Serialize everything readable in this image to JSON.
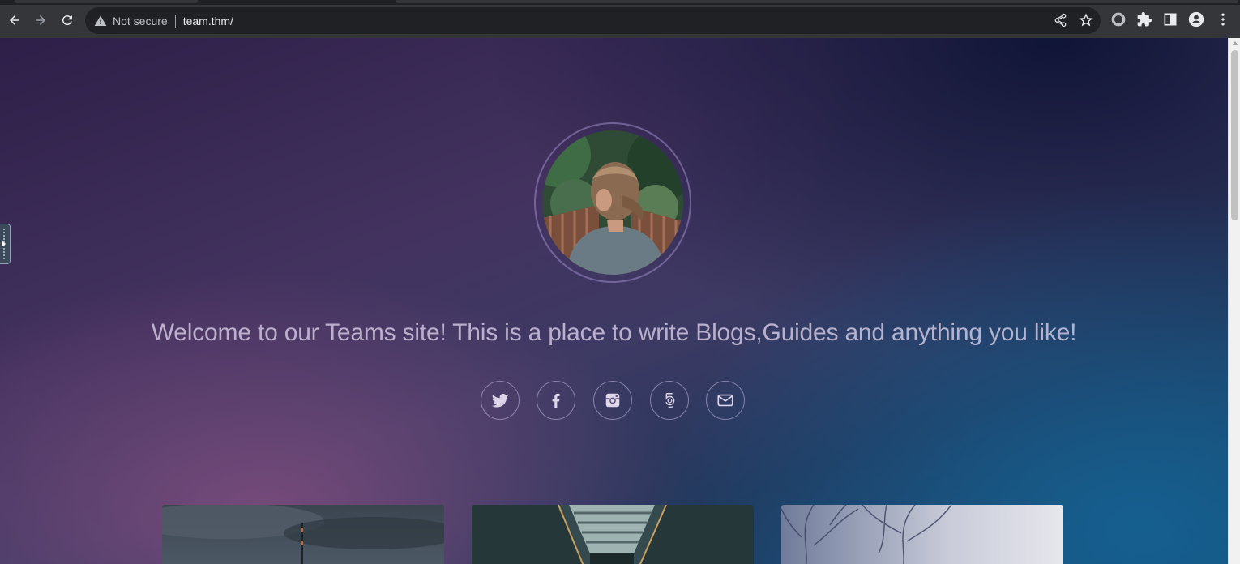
{
  "browser": {
    "security_label": "Not secure",
    "url": "team.thm/"
  },
  "page": {
    "welcome_text": "Welcome to our Teams site! This is a place to write Blogs,Guides and anything you like!",
    "social_links": [
      {
        "name": "twitter-icon"
      },
      {
        "name": "facebook-icon"
      },
      {
        "name": "instagram-icon"
      },
      {
        "name": "500px-icon"
      },
      {
        "name": "email-icon"
      }
    ],
    "cards": [
      {
        "name": "post-card-tower"
      },
      {
        "name": "post-card-corridor"
      },
      {
        "name": "post-card-winter-trees"
      }
    ]
  },
  "colors": {
    "toolbar": "#35363a",
    "omnibox": "#202124",
    "accent_purple": "#7a5383",
    "accent_blue": "#174a72"
  }
}
